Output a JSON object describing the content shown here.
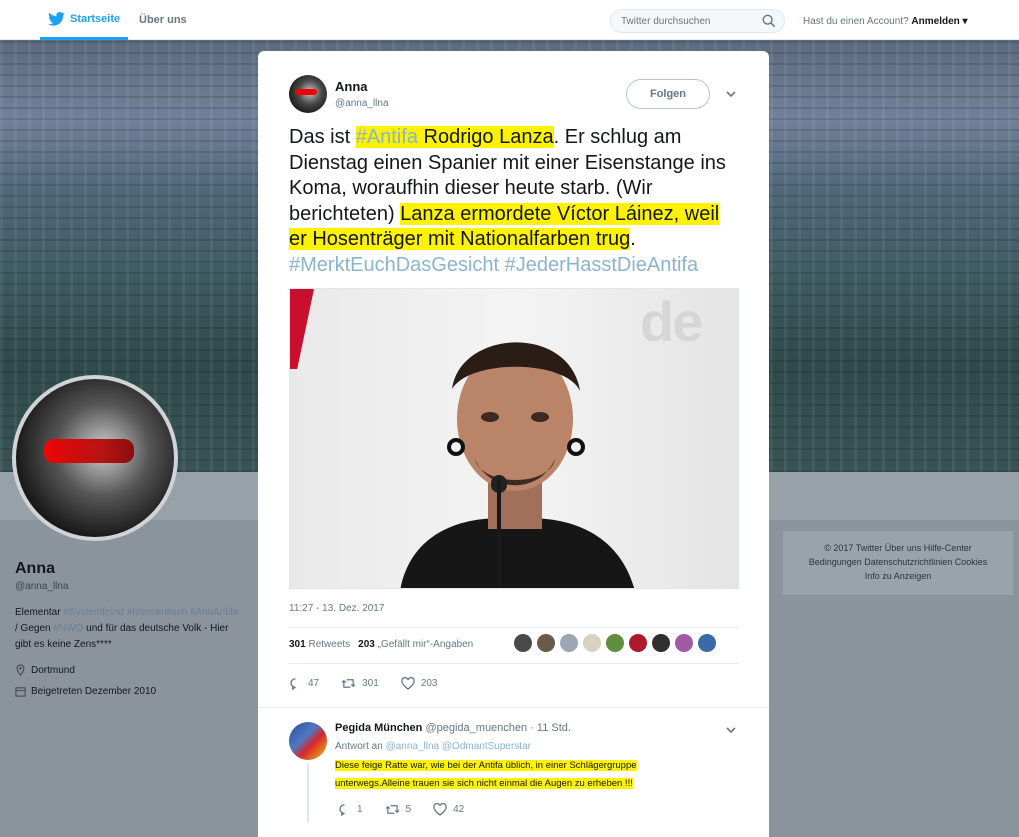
{
  "nav": {
    "home_label": "Startseite",
    "about_label": "Über uns",
    "search_placeholder": "Twitter durchsuchen",
    "account_prompt": "Hast du einen Account?",
    "login_label": "Anmelden ▾"
  },
  "profile": {
    "name": "Anna",
    "handle": "@anna_llna",
    "bio_prefix": "Elementar ",
    "bio_tags_1": "#Systemfeind #Islamkritisch",
    "bio_tag_2": "#AntiAntifa",
    "bio_mid": " / Gegen ",
    "bio_tag_3": "#NWO",
    "bio_suffix": " und für das deutsche Volk - Hier gibt es keine Zens****",
    "location": "Dortmund",
    "joined": "Beigetreten Dezember 2010"
  },
  "footer": {
    "line1": "© 2017 Twitter   Über uns   Hilfe-Center",
    "line2": "Bedingungen   Datenschutzrichtlinien   Cookies",
    "line3": "Info zu Anzeigen"
  },
  "tweet": {
    "author_name": "Anna",
    "author_handle": "@anna_llna",
    "follow_label": "Folgen",
    "text_1": "Das ist ",
    "hashtag_antifa": "#Antifa",
    "text_name": " Rodrigo Lanza",
    "text_2": ". Er schlug am Dienstag einen Spanier mit einer Eisenstange ins Koma, woraufhin dieser heute starb. (Wir berichteten) ",
    "text_hl": "Lanza ermordete Víctor Láinez, weil er Hosenträger mit Nationalfarben trug",
    "text_end": ".",
    "hashtags_line": "#MerktEuchDasGesicht #JederHasstDieAntifa",
    "image_logo": "de",
    "timestamp": "11:27 - 13. Dez. 2017",
    "retweets_count": "301",
    "retweets_label": "Retweets",
    "likes_count": "203",
    "likes_label": "„Gefällt mir“-Angaben",
    "reply_count": "47",
    "retweet_count": "301",
    "like_count": "203",
    "liker_colors": [
      "#4a4a4a",
      "#6b5a4a",
      "#9aa7b5",
      "#d9d2c2",
      "#5f8f3d",
      "#b0182c",
      "#2f2f2f",
      "#a25aa6",
      "#3b6aa8"
    ]
  },
  "reply": {
    "author_name": "Pegida München",
    "author_handle": " @pegida_muenchen · 11 Std.",
    "reply_to_label": "Antwort an ",
    "reply_to_mentions": "@anna_llna @OdmantSuperstar",
    "text": "Diese feige Ratte war, wie bei der Antifa üblich, in einer Schlägergruppe unterwegs.Alleine trauen sie sich nicht einmal die Augen zu erheben !!!",
    "reply_count": "1",
    "retweet_count": "5",
    "like_count": "42"
  },
  "colors": {
    "twitter_blue": "#1da1f2",
    "highlight": "#fff200",
    "hashtag": "#8ab4cf"
  }
}
